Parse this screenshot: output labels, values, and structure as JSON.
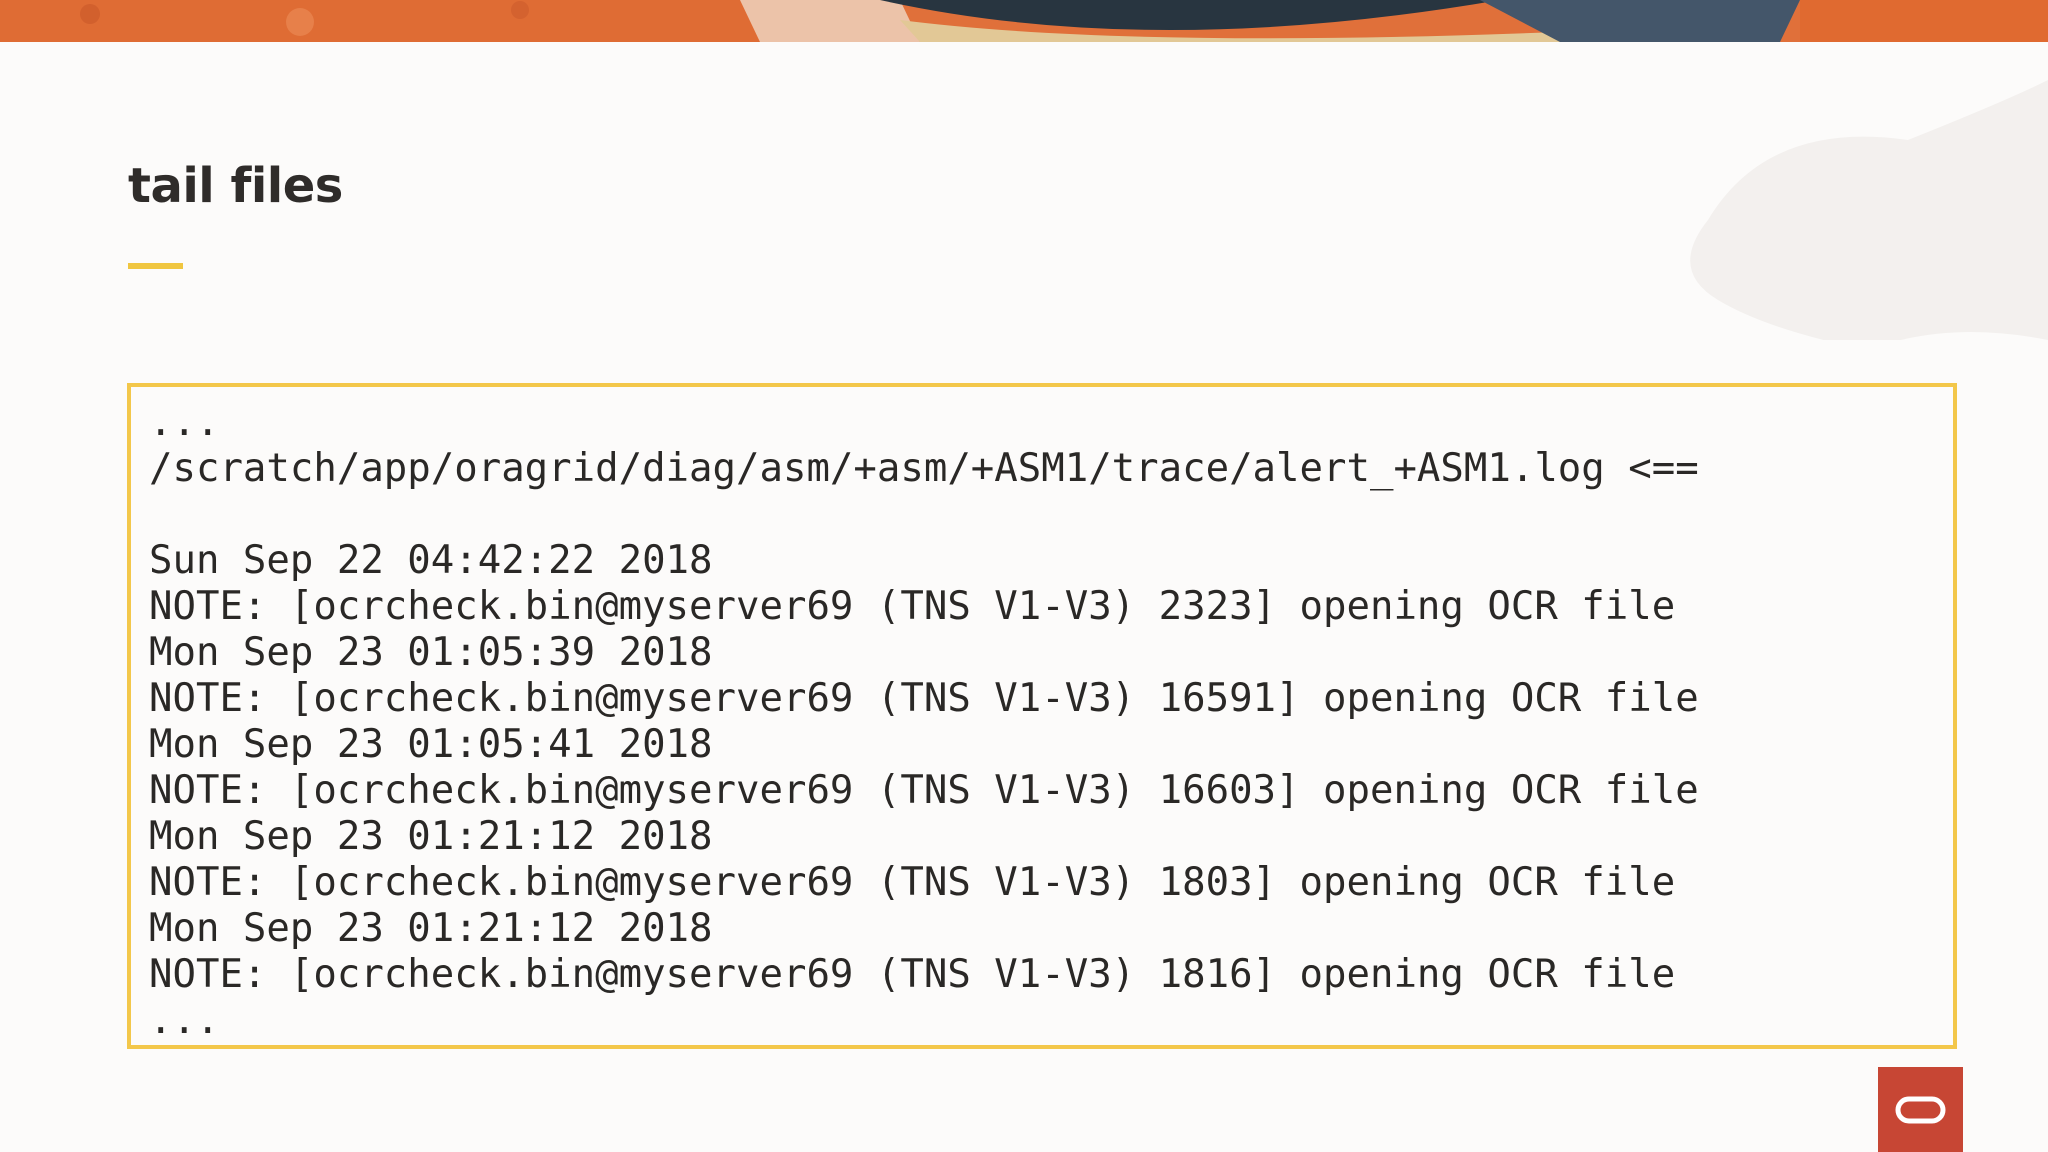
{
  "slide": {
    "title": "tail files"
  },
  "code_block": {
    "lines": [
      "...",
      "/scratch/app/oragrid/diag/asm/+asm/+ASM1/trace/alert_+ASM1.log <==",
      "",
      "Sun Sep 22 04:42:22 2018",
      "NOTE: [ocrcheck.bin@myserver69 (TNS V1-V3) 2323] opening OCR file",
      "Mon Sep 23 01:05:39 2018",
      "NOTE: [ocrcheck.bin@myserver69 (TNS V1-V3) 16591] opening OCR file",
      "Mon Sep 23 01:05:41 2018",
      "NOTE: [ocrcheck.bin@myserver69 (TNS V1-V3) 16603] opening OCR file",
      "Mon Sep 23 01:21:12 2018",
      "NOTE: [ocrcheck.bin@myserver69 (TNS V1-V3) 1803] opening OCR file",
      "Mon Sep 23 01:21:12 2018",
      "NOTE: [ocrcheck.bin@myserver69 (TNS V1-V3) 1816] opening OCR file",
      "..."
    ]
  },
  "colors": {
    "accent": "#f3c74a",
    "brand": "#c74634",
    "banner": "#e0703a"
  },
  "icons": {
    "logo": "oracle-logo-icon"
  }
}
